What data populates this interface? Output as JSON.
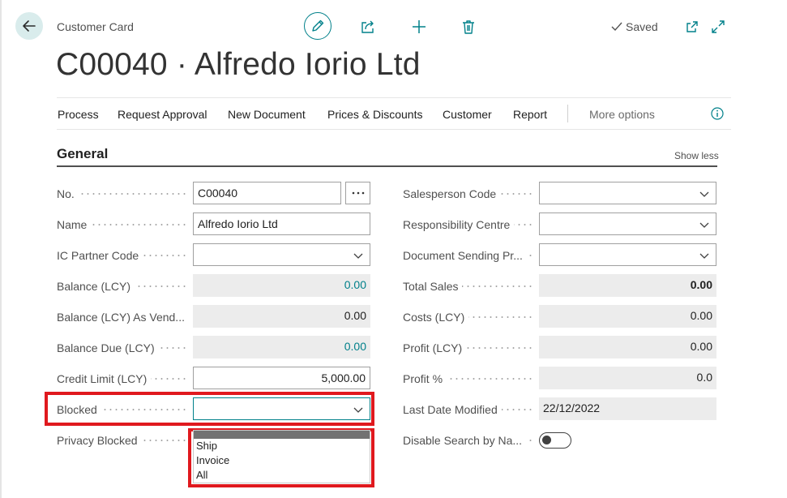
{
  "header": {
    "breadcrumb": "Customer Card",
    "title": "C00040 · Alfredo Iorio Ltd",
    "saved_label": "Saved"
  },
  "actions": {
    "process": "Process",
    "request_approval": "Request Approval",
    "new_document": "New Document",
    "prices_discounts": "Prices & Discounts",
    "customer": "Customer",
    "report": "Report",
    "more_options": "More options"
  },
  "general": {
    "title": "General",
    "show_less": "Show less",
    "left": [
      {
        "label": "No.",
        "value": "C00040"
      },
      {
        "label": "Name",
        "value": "Alfredo Iorio Ltd"
      },
      {
        "label": "IC Partner Code",
        "value": ""
      },
      {
        "label": "Balance (LCY)",
        "value": "0.00"
      },
      {
        "label": "Balance (LCY) As Vend...",
        "value": "0.00"
      },
      {
        "label": "Balance Due (LCY)",
        "value": "0.00"
      },
      {
        "label": "Credit Limit (LCY)",
        "value": "5,000.00"
      },
      {
        "label": "Blocked",
        "value": ""
      },
      {
        "label": "Privacy Blocked",
        "value": ""
      }
    ],
    "right": [
      {
        "label": "Salesperson Code",
        "value": ""
      },
      {
        "label": "Responsibility Centre",
        "value": ""
      },
      {
        "label": "Document Sending Pr...",
        "value": ""
      },
      {
        "label": "Total Sales",
        "value": "0.00"
      },
      {
        "label": "Costs (LCY)",
        "value": "0.00"
      },
      {
        "label": "Profit (LCY)",
        "value": "0.00"
      },
      {
        "label": "Profit %",
        "value": "0.0"
      },
      {
        "label": "Last Date Modified",
        "value": "22/12/2022"
      },
      {
        "label": "Disable Search by Na...",
        "value": ""
      }
    ]
  },
  "blocked_dropdown": {
    "options": [
      "",
      "Ship",
      "Invoice",
      "All"
    ]
  },
  "colors": {
    "accent": "#00808a",
    "highlight": "#e0191e"
  },
  "icons": [
    "arrow-left-icon",
    "pencil-icon",
    "share-icon",
    "plus-icon",
    "trash-icon",
    "check-icon",
    "popout-icon",
    "expand-icon",
    "info-icon",
    "chevron-down-icon",
    "ellipsis-icon"
  ]
}
